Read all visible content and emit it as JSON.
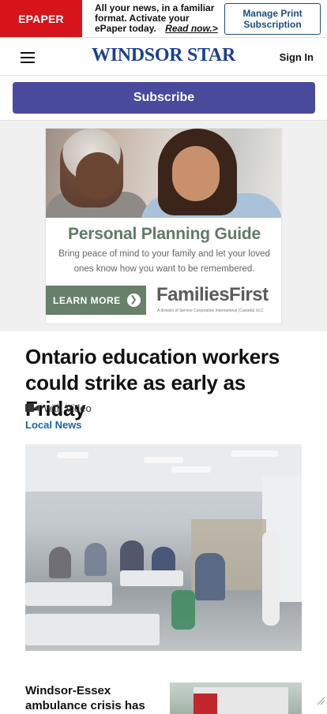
{
  "epaper": {
    "badge": "EPAPER",
    "message": "All your news, in a familiar format. Activate your ePaper today.",
    "read_now": "Read now.>",
    "manage_button": "Manage Print Subscription"
  },
  "header": {
    "menu_icon": "hamburger-menu-icon",
    "logo": "WINDSOR STAR",
    "sign_in": "Sign In"
  },
  "subscribe": {
    "label": "Subscribe"
  },
  "ad": {
    "title": "Personal Planning Guide",
    "body": "Bring peace of mind to your family and let your loved ones know how you want to be remembered.",
    "cta": "LEARN MORE",
    "cta_icon": "arrow-right-circle-icon",
    "brand": "FamiliesFirst",
    "brand_sub": "A division of Service Corporation International (Canada) ULC",
    "colors": {
      "green": "#66806a",
      "title_green": "#617a66"
    }
  },
  "article": {
    "headline": "Ontario education workers could strike as early as Friday",
    "video_icon": "video-camera-icon",
    "video_label": "with Video",
    "category": "Local News"
  },
  "story2": {
    "headline": "Windsor-Essex ambulance crisis has"
  },
  "colors": {
    "epaper_red": "#d7141a",
    "brand_blue": "#1d3f8f",
    "subscribe_purple": "#4a4a9d",
    "link_blue": "#1a65a8"
  }
}
